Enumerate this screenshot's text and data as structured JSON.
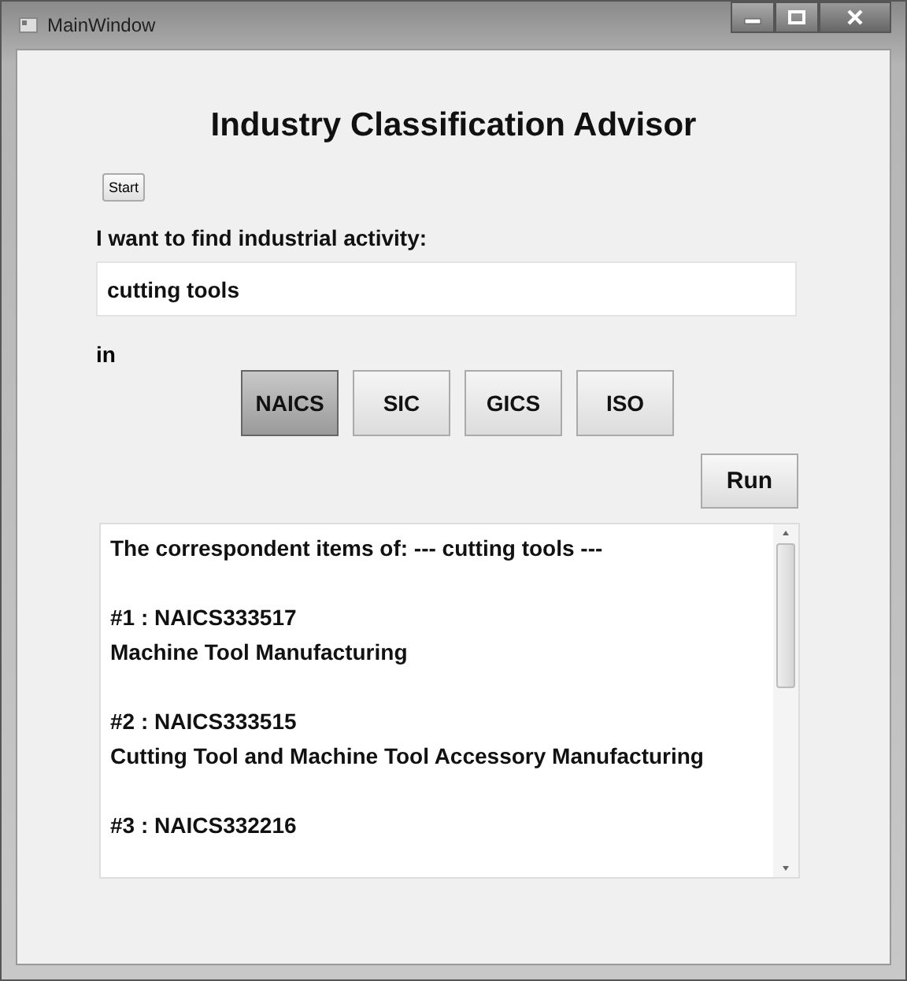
{
  "window": {
    "title": "MainWindow"
  },
  "heading": "Industry Classification Advisor",
  "start_button": "Start",
  "query": {
    "label": "I want to find industrial activity:",
    "value": "cutting tools"
  },
  "in_label": "in",
  "systems": [
    {
      "label": "NAICS",
      "selected": true
    },
    {
      "label": "SIC",
      "selected": false
    },
    {
      "label": "GICS",
      "selected": false
    },
    {
      "label": "ISO",
      "selected": false
    }
  ],
  "run_button": "Run",
  "results": {
    "header": "The correspondent items of: --- cutting tools  ---",
    "items": [
      {
        "code": "#1 : NAICS333517",
        "description": "Machine Tool Manufacturing"
      },
      {
        "code": "#2 : NAICS333515",
        "description": "Cutting Tool and Machine Tool Accessory Manufacturing"
      },
      {
        "code": "#3 : NAICS332216"
      }
    ]
  }
}
